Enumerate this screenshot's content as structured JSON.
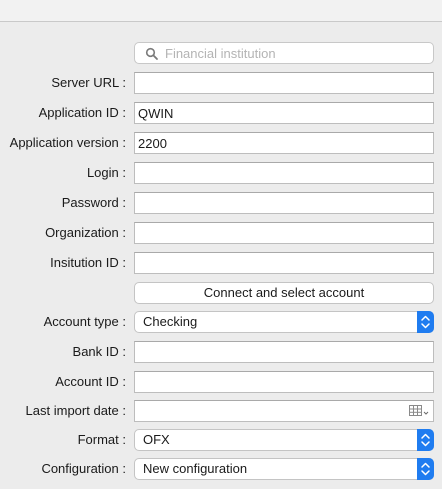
{
  "search": {
    "placeholder": "Financial institution",
    "icon": "search-icon"
  },
  "fields": {
    "server_url": {
      "label": "Server URL :",
      "value": ""
    },
    "application_id": {
      "label": "Application ID :",
      "value": "QWIN"
    },
    "application_version": {
      "label": "Application version :",
      "value": "2200"
    },
    "login": {
      "label": "Login :",
      "value": ""
    },
    "password": {
      "label": "Password :",
      "value": ""
    },
    "organization": {
      "label": "Organization :",
      "value": ""
    },
    "institution_id": {
      "label": "Insitution ID :",
      "value": ""
    },
    "bank_id": {
      "label": "Bank ID :",
      "value": ""
    },
    "account_id": {
      "label": "Account ID :",
      "value": ""
    },
    "last_import_date": {
      "label": "Last import date :",
      "value": ""
    }
  },
  "connect_button": {
    "label": "Connect and select account"
  },
  "selects": {
    "account_type": {
      "label": "Account type :",
      "value": "Checking"
    },
    "format": {
      "label": "Format :",
      "value": "OFX"
    },
    "configuration": {
      "label": "Configuration :",
      "value": "New configuration"
    }
  },
  "colors": {
    "accent": "#1f7cf0",
    "background": "#ececec"
  }
}
